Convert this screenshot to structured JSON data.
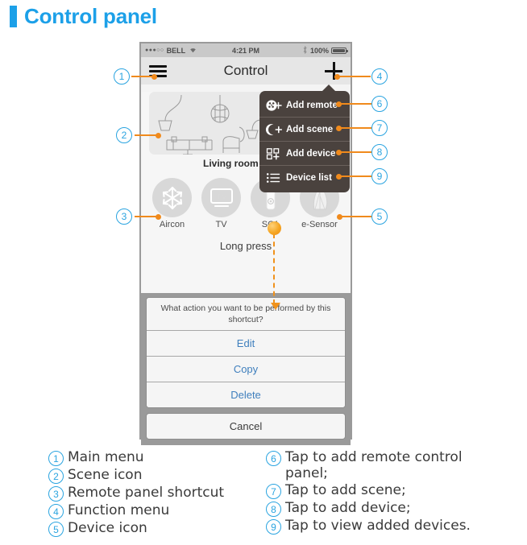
{
  "heading": {
    "title": "Control panel",
    "accent_color": "#1ca0e8"
  },
  "phone": {
    "status_bar": {
      "signal_dots": "●●●○○",
      "carrier": "BELL",
      "wifi_icon": "wifi-icon",
      "time": "4:21 PM",
      "bluetooth_icon": "bluetooth-icon",
      "battery_percent": "100%",
      "battery_icon": "battery-full-icon"
    },
    "nav_bar": {
      "menu_icon": "hamburger-menu-icon",
      "title": "Control",
      "add_icon": "plus-icon"
    },
    "scene_card": {
      "label": "Living room scene",
      "image": "living-room-illustration"
    },
    "devices": [
      {
        "label": "Aircon",
        "icon": "snowflake-icon"
      },
      {
        "label": "TV",
        "icon": "tv-icon"
      },
      {
        "label": "SC1",
        "icon": "sensor-controller-icon",
        "pressed": true
      },
      {
        "label": "e-Sensor",
        "icon": "e-sensor-icon"
      }
    ],
    "long_press_note": "Long press",
    "action_sheet": {
      "prompt": "What action you want to be performed by this shortcut?",
      "items": [
        "Edit",
        "Copy",
        "Delete"
      ],
      "cancel": "Cancel",
      "item_color": "#3f7fbd"
    }
  },
  "dropdown": {
    "items": [
      {
        "label": "Add remote",
        "icon": "add-remote-icon"
      },
      {
        "label": "Add scene",
        "icon": "add-scene-moon-icon"
      },
      {
        "label": "Add device",
        "icon": "add-device-grid-icon"
      },
      {
        "label": "Device list",
        "icon": "device-list-icon"
      }
    ],
    "background_color": "#4a423e"
  },
  "callouts": [
    "1",
    "2",
    "3",
    "4",
    "5",
    "6",
    "7",
    "8",
    "9"
  ],
  "legend": {
    "left": [
      {
        "num": "1",
        "text": "Main menu"
      },
      {
        "num": "2",
        "text": "Scene icon"
      },
      {
        "num": "3",
        "text": "Remote panel shortcut"
      },
      {
        "num": "4",
        "text": "Function menu"
      },
      {
        "num": "5",
        "text": "Device icon"
      }
    ],
    "right": [
      {
        "num": "6",
        "text": "Tap to add remote control panel;"
      },
      {
        "num": "7",
        "text": "Tap to add scene;"
      },
      {
        "num": "8",
        "text": "Tap to add device;"
      },
      {
        "num": "9",
        "text": "Tap to view added devices."
      }
    ]
  },
  "colors": {
    "accent_blue": "#2aa4e0",
    "lead_orange": "#f08a1c"
  }
}
